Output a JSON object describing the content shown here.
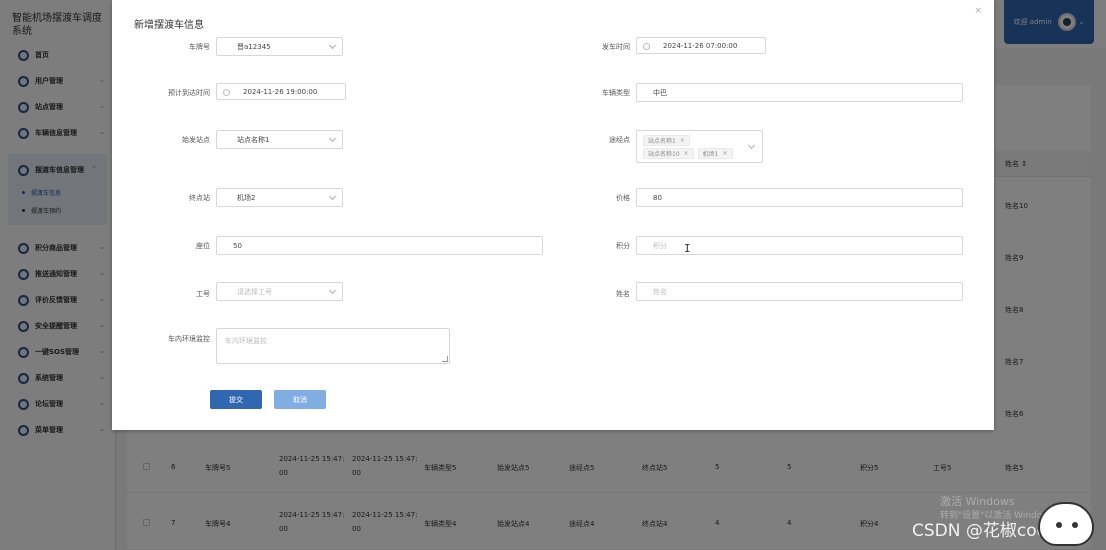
{
  "app": {
    "title": "智能机场摆渡车调度系统",
    "welcome": "欢迎 admin",
    "sidebar": {
      "items": [
        {
          "label": "首页"
        },
        {
          "label": "用户管理"
        },
        {
          "label": "站点管理"
        },
        {
          "label": "车辆信息管理"
        }
      ],
      "active_group": {
        "label": "摆渡车信息管理",
        "children": [
          {
            "label": "摆渡车信息"
          },
          {
            "label": "摆渡车预约"
          }
        ]
      },
      "items_after": [
        {
          "label": "积分商品管理"
        },
        {
          "label": "推送通知管理"
        },
        {
          "label": "评价反馈管理"
        },
        {
          "label": "安全提醒管理"
        },
        {
          "label": "一键SOS管理"
        },
        {
          "label": "系统管理"
        },
        {
          "label": "论坛管理"
        },
        {
          "label": "菜单管理"
        }
      ]
    },
    "table": {
      "name_header": "姓名 ↕",
      "side_names": [
        "姓名10",
        "姓名9",
        "姓名8",
        "姓名7",
        "姓名6"
      ],
      "rows": [
        {
          "no": "6",
          "plate": "车牌号5",
          "depart": "2024-11-25 15:47:",
          "depart2": "00",
          "arrive": "2024-11-25 15:47:",
          "arrive2": "00",
          "type": "车辆类型5",
          "start": "始发站点5",
          "via": "途经点5",
          "end": "终点站5",
          "price": "5",
          "seat": "5",
          "points": "积分5",
          "job": "工号5",
          "name": "姓名5"
        },
        {
          "no": "7",
          "plate": "车牌号4",
          "depart": "2024-11-25 15:47:",
          "depart2": "00",
          "arrive": "2024-11-25 15:47:",
          "arrive2": "00",
          "type": "车辆类型4",
          "start": "始发站点4",
          "via": "途经点4",
          "end": "终点站4",
          "price": "4",
          "seat": "4",
          "points": "积分4",
          "job": "工号4",
          "name": ""
        }
      ]
    }
  },
  "dialog": {
    "title": "新增摆渡车信息",
    "close_label": "×",
    "fields": {
      "plate": {
        "label": "车牌号",
        "value": "晋a12345"
      },
      "depart_time": {
        "label": "发车时间",
        "value": "2024-11-26 07:00:00"
      },
      "arrive_time": {
        "label": "预计到达时间",
        "value": "2024-11-26 19:00:00"
      },
      "vehicle_type": {
        "label": "车辆类型",
        "value": "中巴"
      },
      "start_station": {
        "label": "始发站点",
        "value": "站点名称1"
      },
      "via": {
        "label": "途经点",
        "tags": [
          "站点名称1",
          "站点名称10",
          "机场1"
        ]
      },
      "end_station": {
        "label": "终点站",
        "value": "机场2"
      },
      "price": {
        "label": "价格",
        "value": "80"
      },
      "seats": {
        "label": "座位",
        "value": "50"
      },
      "points": {
        "label": "积分",
        "placeholder": "积分"
      },
      "job_no": {
        "label": "工号",
        "placeholder": "请选择工号"
      },
      "name": {
        "label": "姓名",
        "placeholder": "姓名"
      },
      "env": {
        "label": "车内环境监控",
        "placeholder": "车内环境监控"
      }
    },
    "buttons": {
      "submit": "提交",
      "cancel": "取消"
    }
  },
  "watermarks": {
    "windows_line1": "激活 Windows",
    "windows_line2": "转到\"设置\"以激活 Windows。",
    "csdn": "CSDN @花椒coding"
  }
}
